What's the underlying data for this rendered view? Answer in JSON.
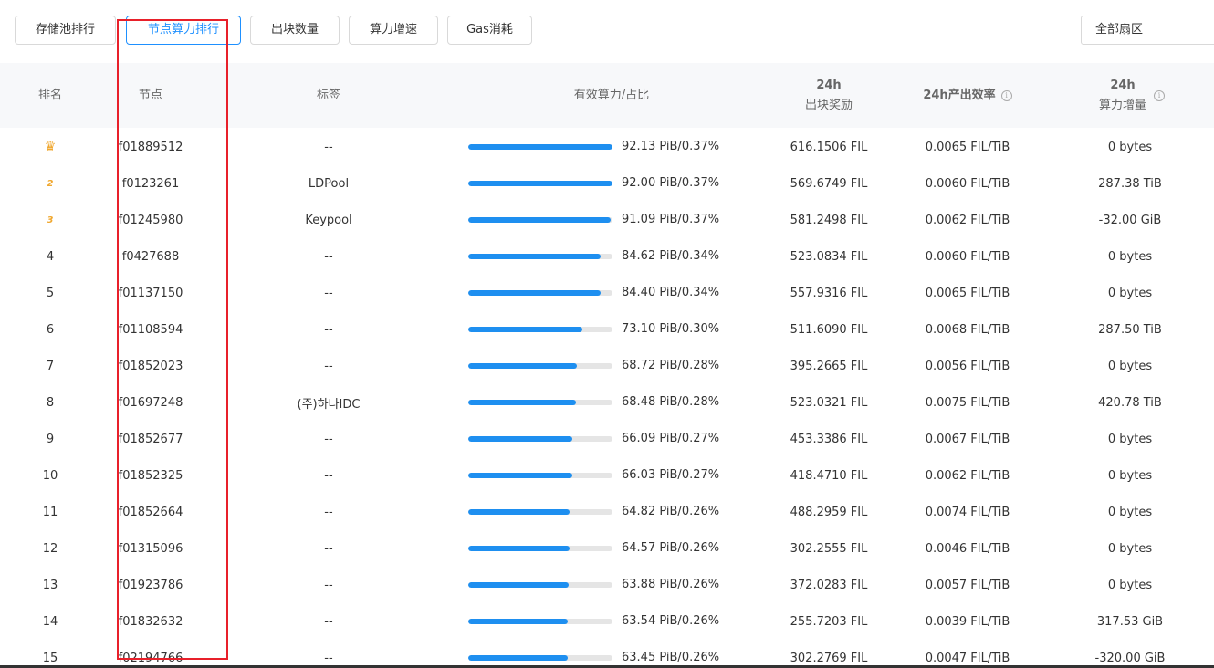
{
  "tabs": [
    {
      "label": "存储池排行",
      "active": false
    },
    {
      "label": "节点算力排行",
      "active": true
    },
    {
      "label": "出块数量",
      "active": false
    },
    {
      "label": "算力增速",
      "active": false
    },
    {
      "label": "Gas消耗",
      "active": false
    }
  ],
  "region_select": {
    "value": "全部扇区"
  },
  "table": {
    "headers": {
      "rank": "排名",
      "node": "节点",
      "tag": "标签",
      "power": "有效算力/占比",
      "reward_top": "24h",
      "reward_bottom": "出块奖励",
      "efficiency": "24h产出效率",
      "growth_top": "24h",
      "growth_bottom": "算力增量"
    },
    "rows": [
      {
        "rank": "",
        "rank_icon": "crown-icon",
        "node": "f01889512",
        "tag": "--",
        "power_text": "92.13 PiB/0.37%",
        "fill": 1.0,
        "reward": "616.1506 FIL",
        "efficiency": "0.0065 FIL/TiB",
        "growth": "0 bytes"
      },
      {
        "rank": "2",
        "rank_icon": "medal-2",
        "node": "f0123261",
        "tag": "LDPool",
        "power_text": "92.00 PiB/0.37%",
        "fill": 0.999,
        "reward": "569.6749 FIL",
        "efficiency": "0.0060 FIL/TiB",
        "growth": "287.38 TiB"
      },
      {
        "rank": "3",
        "rank_icon": "medal-3",
        "node": "f01245980",
        "tag": "Keypool",
        "power_text": "91.09 PiB/0.37%",
        "fill": 0.99,
        "reward": "581.2498 FIL",
        "efficiency": "0.0062 FIL/TiB",
        "growth": "-32.00 GiB"
      },
      {
        "rank": "4",
        "node": "f0427688",
        "tag": "--",
        "power_text": "84.62 PiB/0.34%",
        "fill": 0.92,
        "reward": "523.0834 FIL",
        "efficiency": "0.0060 FIL/TiB",
        "growth": "0 bytes"
      },
      {
        "rank": "5",
        "node": "f01137150",
        "tag": "--",
        "power_text": "84.40 PiB/0.34%",
        "fill": 0.92,
        "reward": "557.9316 FIL",
        "efficiency": "0.0065 FIL/TiB",
        "growth": "0 bytes"
      },
      {
        "rank": "6",
        "node": "f01108594",
        "tag": "--",
        "power_text": "73.10 PiB/0.30%",
        "fill": 0.79,
        "reward": "511.6090 FIL",
        "efficiency": "0.0068 FIL/TiB",
        "growth": "287.50 TiB"
      },
      {
        "rank": "7",
        "node": "f01852023",
        "tag": "--",
        "power_text": "68.72 PiB/0.28%",
        "fill": 0.75,
        "reward": "395.2665 FIL",
        "efficiency": "0.0056 FIL/TiB",
        "growth": "0 bytes"
      },
      {
        "rank": "8",
        "node": "f01697248",
        "tag": "(주)하나IDC",
        "power_text": "68.48 PiB/0.28%",
        "fill": 0.745,
        "reward": "523.0321 FIL",
        "efficiency": "0.0075 FIL/TiB",
        "growth": "420.78 TiB"
      },
      {
        "rank": "9",
        "node": "f01852677",
        "tag": "--",
        "power_text": "66.09 PiB/0.27%",
        "fill": 0.72,
        "reward": "453.3386 FIL",
        "efficiency": "0.0067 FIL/TiB",
        "growth": "0 bytes"
      },
      {
        "rank": "10",
        "node": "f01852325",
        "tag": "--",
        "power_text": "66.03 PiB/0.27%",
        "fill": 0.72,
        "reward": "418.4710 FIL",
        "efficiency": "0.0062 FIL/TiB",
        "growth": "0 bytes"
      },
      {
        "rank": "11",
        "node": "f01852664",
        "tag": "--",
        "power_text": "64.82 PiB/0.26%",
        "fill": 0.705,
        "reward": "488.2959 FIL",
        "efficiency": "0.0074 FIL/TiB",
        "growth": "0 bytes"
      },
      {
        "rank": "12",
        "node": "f01315096",
        "tag": "--",
        "power_text": "64.57 PiB/0.26%",
        "fill": 0.7,
        "reward": "302.2555 FIL",
        "efficiency": "0.0046 FIL/TiB",
        "growth": "0 bytes"
      },
      {
        "rank": "13",
        "node": "f01923786",
        "tag": "--",
        "power_text": "63.88 PiB/0.26%",
        "fill": 0.695,
        "reward": "372.0283 FIL",
        "efficiency": "0.0057 FIL/TiB",
        "growth": "0 bytes"
      },
      {
        "rank": "14",
        "node": "f01832632",
        "tag": "--",
        "power_text": "63.54 PiB/0.26%",
        "fill": 0.69,
        "reward": "255.7203 FIL",
        "efficiency": "0.0039 FIL/TiB",
        "growth": "317.53 GiB"
      },
      {
        "rank": "15",
        "node": "f02194766",
        "tag": "--",
        "power_text": "63.45 PiB/0.26%",
        "fill": 0.69,
        "reward": "302.2769 FIL",
        "efficiency": "0.0047 FIL/TiB",
        "growth": "-320.00 GiB"
      }
    ]
  },
  "colors": {
    "accent": "#1e8ff0",
    "highlight": "#e8202a",
    "medal": "#f0a830"
  }
}
